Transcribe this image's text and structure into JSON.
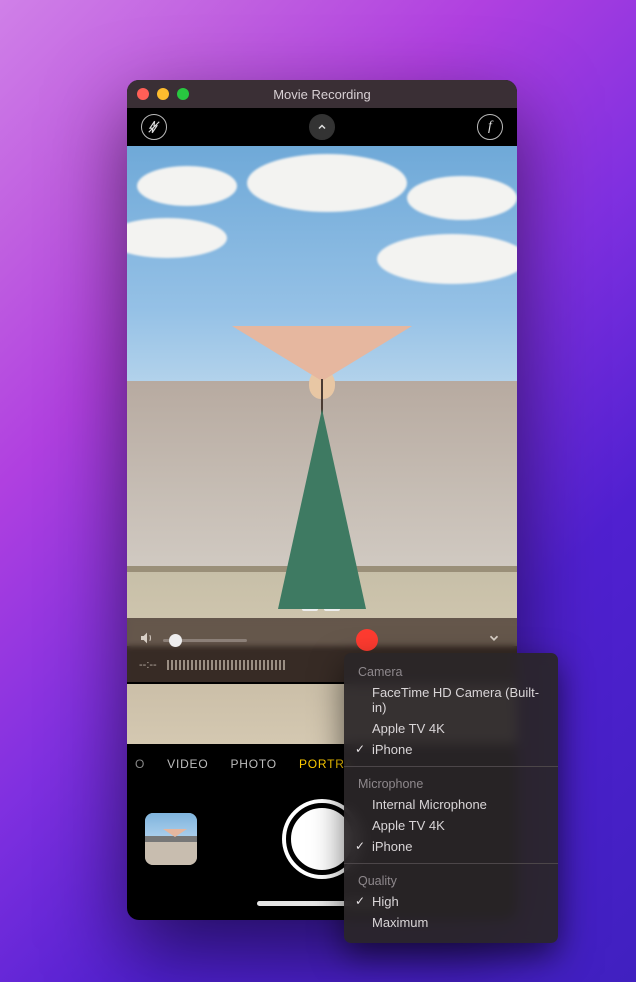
{
  "window": {
    "title": "Movie Recording"
  },
  "qt": {
    "time": "--:--"
  },
  "modes": {
    "cut": "O",
    "items": [
      "VIDEO",
      "PHOTO",
      "PORTRA"
    ]
  },
  "menu": {
    "sections": [
      {
        "title": "Camera",
        "items": [
          {
            "label": "FaceTime HD Camera (Built-in)",
            "checked": false
          },
          {
            "label": "Apple TV 4K",
            "checked": false
          },
          {
            "label": "iPhone",
            "checked": true
          }
        ]
      },
      {
        "title": "Microphone",
        "items": [
          {
            "label": "Internal Microphone",
            "checked": false
          },
          {
            "label": "Apple TV 4K",
            "checked": false
          },
          {
            "label": "iPhone",
            "checked": true
          }
        ]
      },
      {
        "title": "Quality",
        "items": [
          {
            "label": "High",
            "checked": true
          },
          {
            "label": "Maximum",
            "checked": false
          }
        ]
      }
    ]
  }
}
